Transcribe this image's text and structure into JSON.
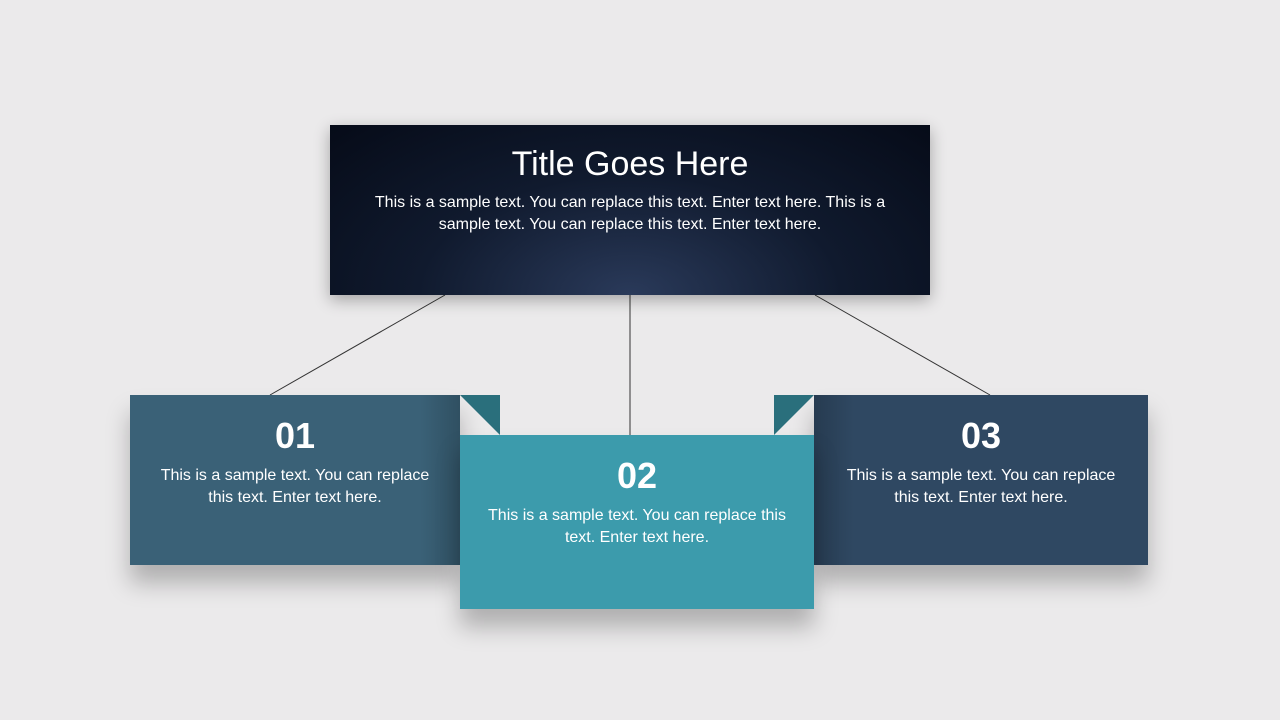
{
  "header": {
    "title": "Title Goes Here",
    "subtitle": "This is a sample text. You can replace this text. Enter text here. This is a sample text. You can replace this text. Enter text here."
  },
  "cards": [
    {
      "number": "01",
      "text": "This is a sample text. You can replace this text. Enter text here."
    },
    {
      "number": "02",
      "text": "This is a sample text. You can replace this text. Enter text here."
    },
    {
      "number": "03",
      "text": "This is a sample text. You can replace this text. Enter text here."
    }
  ]
}
